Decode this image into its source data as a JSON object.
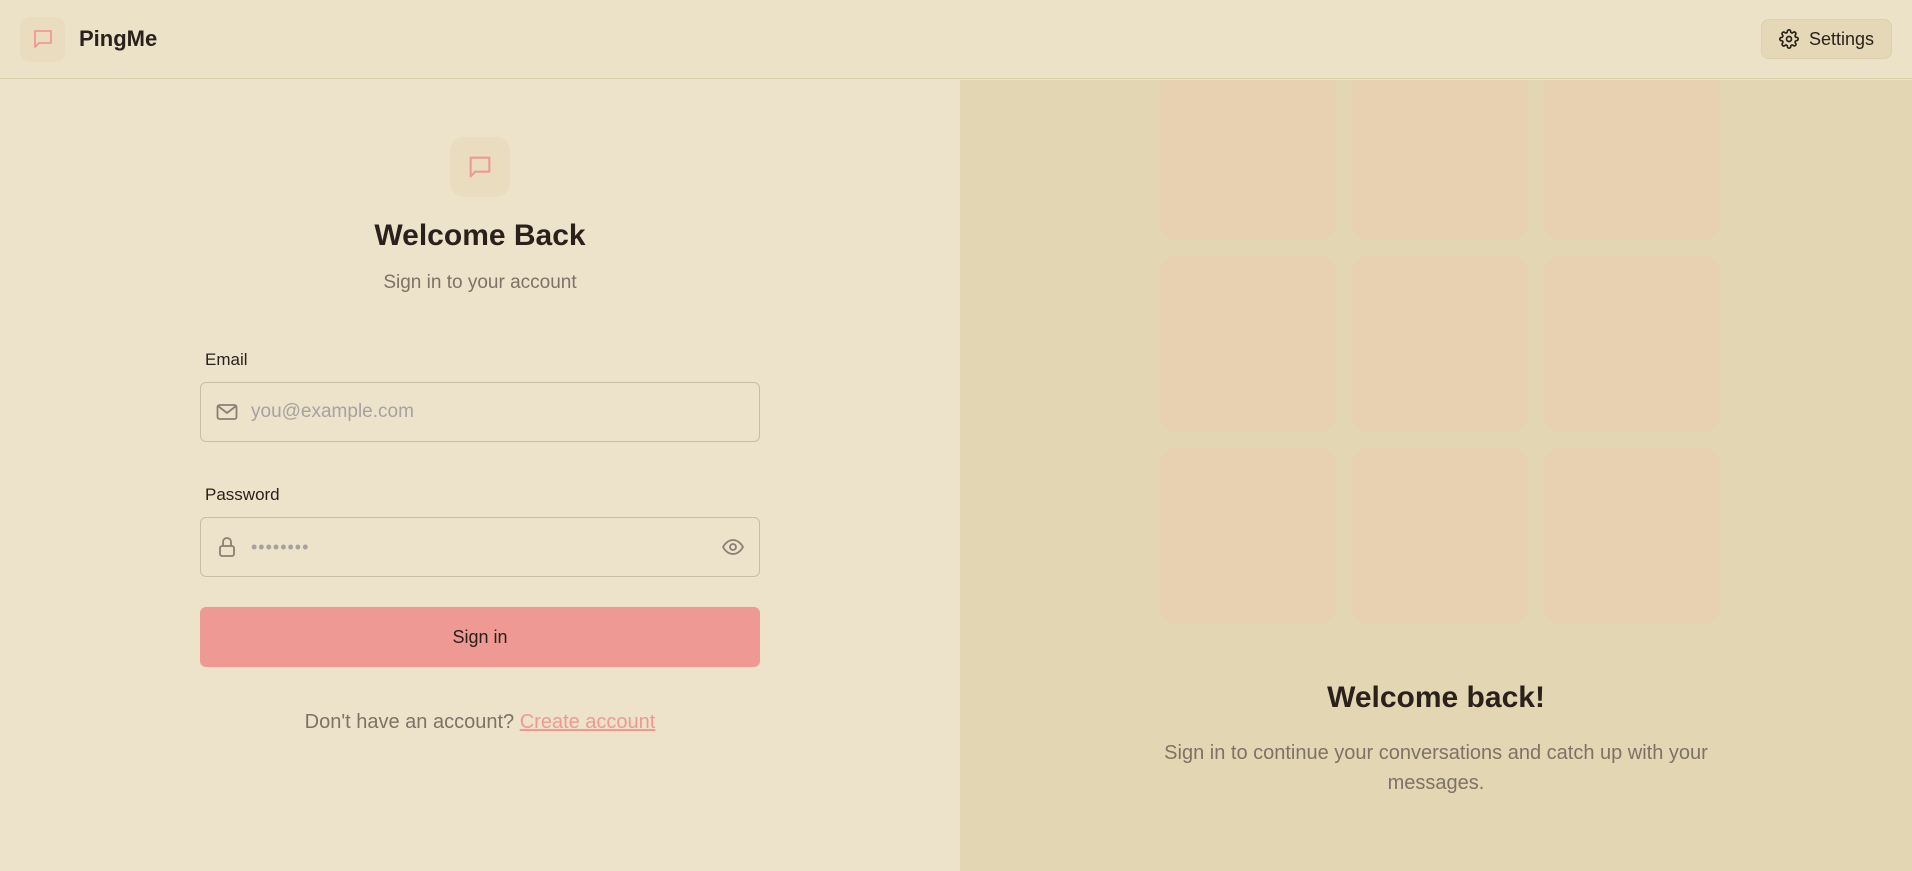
{
  "header": {
    "app_name": "PingMe",
    "settings_label": "Settings"
  },
  "login": {
    "title": "Welcome Back",
    "subtitle": "Sign in to your account",
    "email_label": "Email",
    "email_placeholder": "you@example.com",
    "email_value": "",
    "password_label": "Password",
    "password_mask": "••••••••",
    "signin_label": "Sign in",
    "no_account_text": "Don't have an account?",
    "create_account_label": "Create account"
  },
  "promo": {
    "title": "Welcome back!",
    "text": "Sign in to continue your conversations and catch up with your messages."
  },
  "icons": {
    "brand": "message-square-icon",
    "settings": "gear-icon",
    "email": "mail-icon",
    "password": "lock-icon",
    "toggle": "eye-icon"
  },
  "colors": {
    "accent": "#ee9993",
    "background": "#ede3ca",
    "panel": "#e3d7b3",
    "tile": "#e7d1b0"
  }
}
